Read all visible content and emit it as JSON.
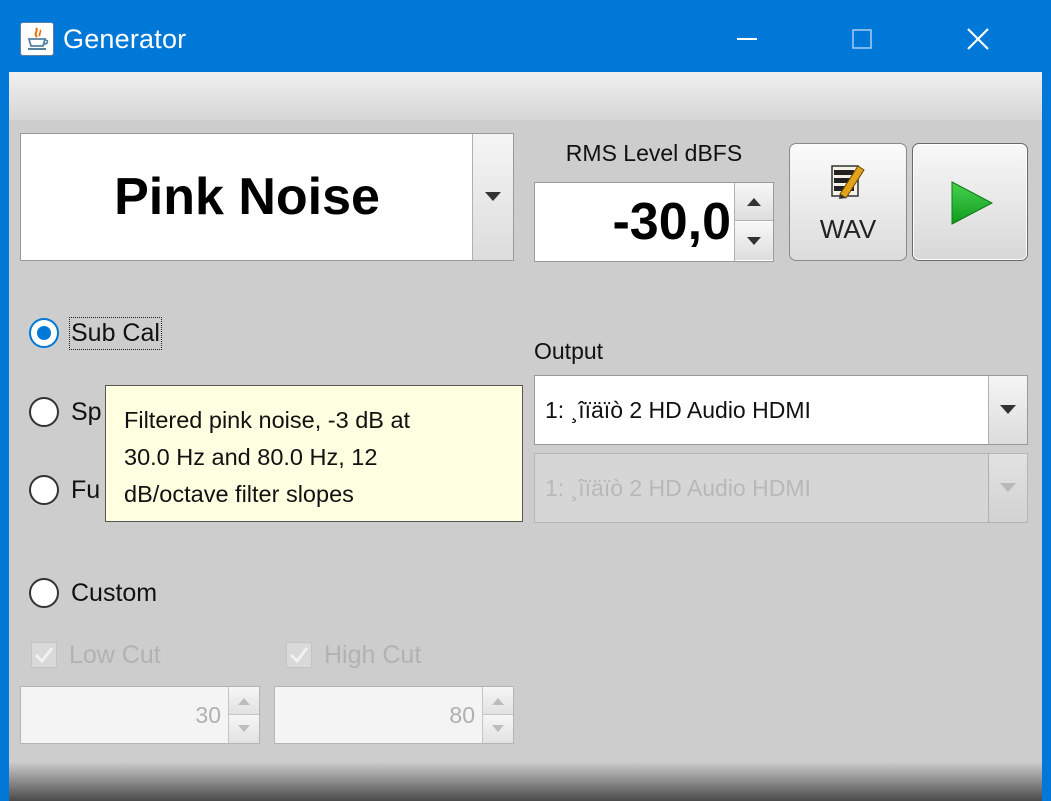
{
  "window": {
    "title": "Generator"
  },
  "generator": {
    "signal_type": "Pink Noise"
  },
  "rms": {
    "label": "RMS Level dBFS",
    "value": "-30,0"
  },
  "buttons": {
    "wav_label": "WAV",
    "play_icon": "play-icon"
  },
  "modes": [
    {
      "label": "Sub Cal",
      "selected": true
    },
    {
      "label": "Sp",
      "selected": false
    },
    {
      "label": "Fu",
      "selected": false
    },
    {
      "label": "Custom",
      "selected": false
    }
  ],
  "tooltip": {
    "lines": [
      "Filtered pink noise, -3 dB at",
      "30.0 Hz and 80.0 Hz, 12",
      "dB/octave filter slopes"
    ]
  },
  "output": {
    "label": "Output",
    "device": "1: ¸îïäïò 2 HD Audio HDMI",
    "device_disabled": "1: ¸îïäïò 2 HD Audio HDMI"
  },
  "custom": {
    "low_cut": {
      "label": "Low Cut",
      "checked": true,
      "value": "30"
    },
    "high_cut": {
      "label": "High Cut",
      "checked": true,
      "value": "80"
    }
  },
  "colors": {
    "titlebar": "#0078d7",
    "accent": "#0078d7",
    "play_green": "#1fae2b",
    "tooltip_bg": "#ffffe1"
  }
}
